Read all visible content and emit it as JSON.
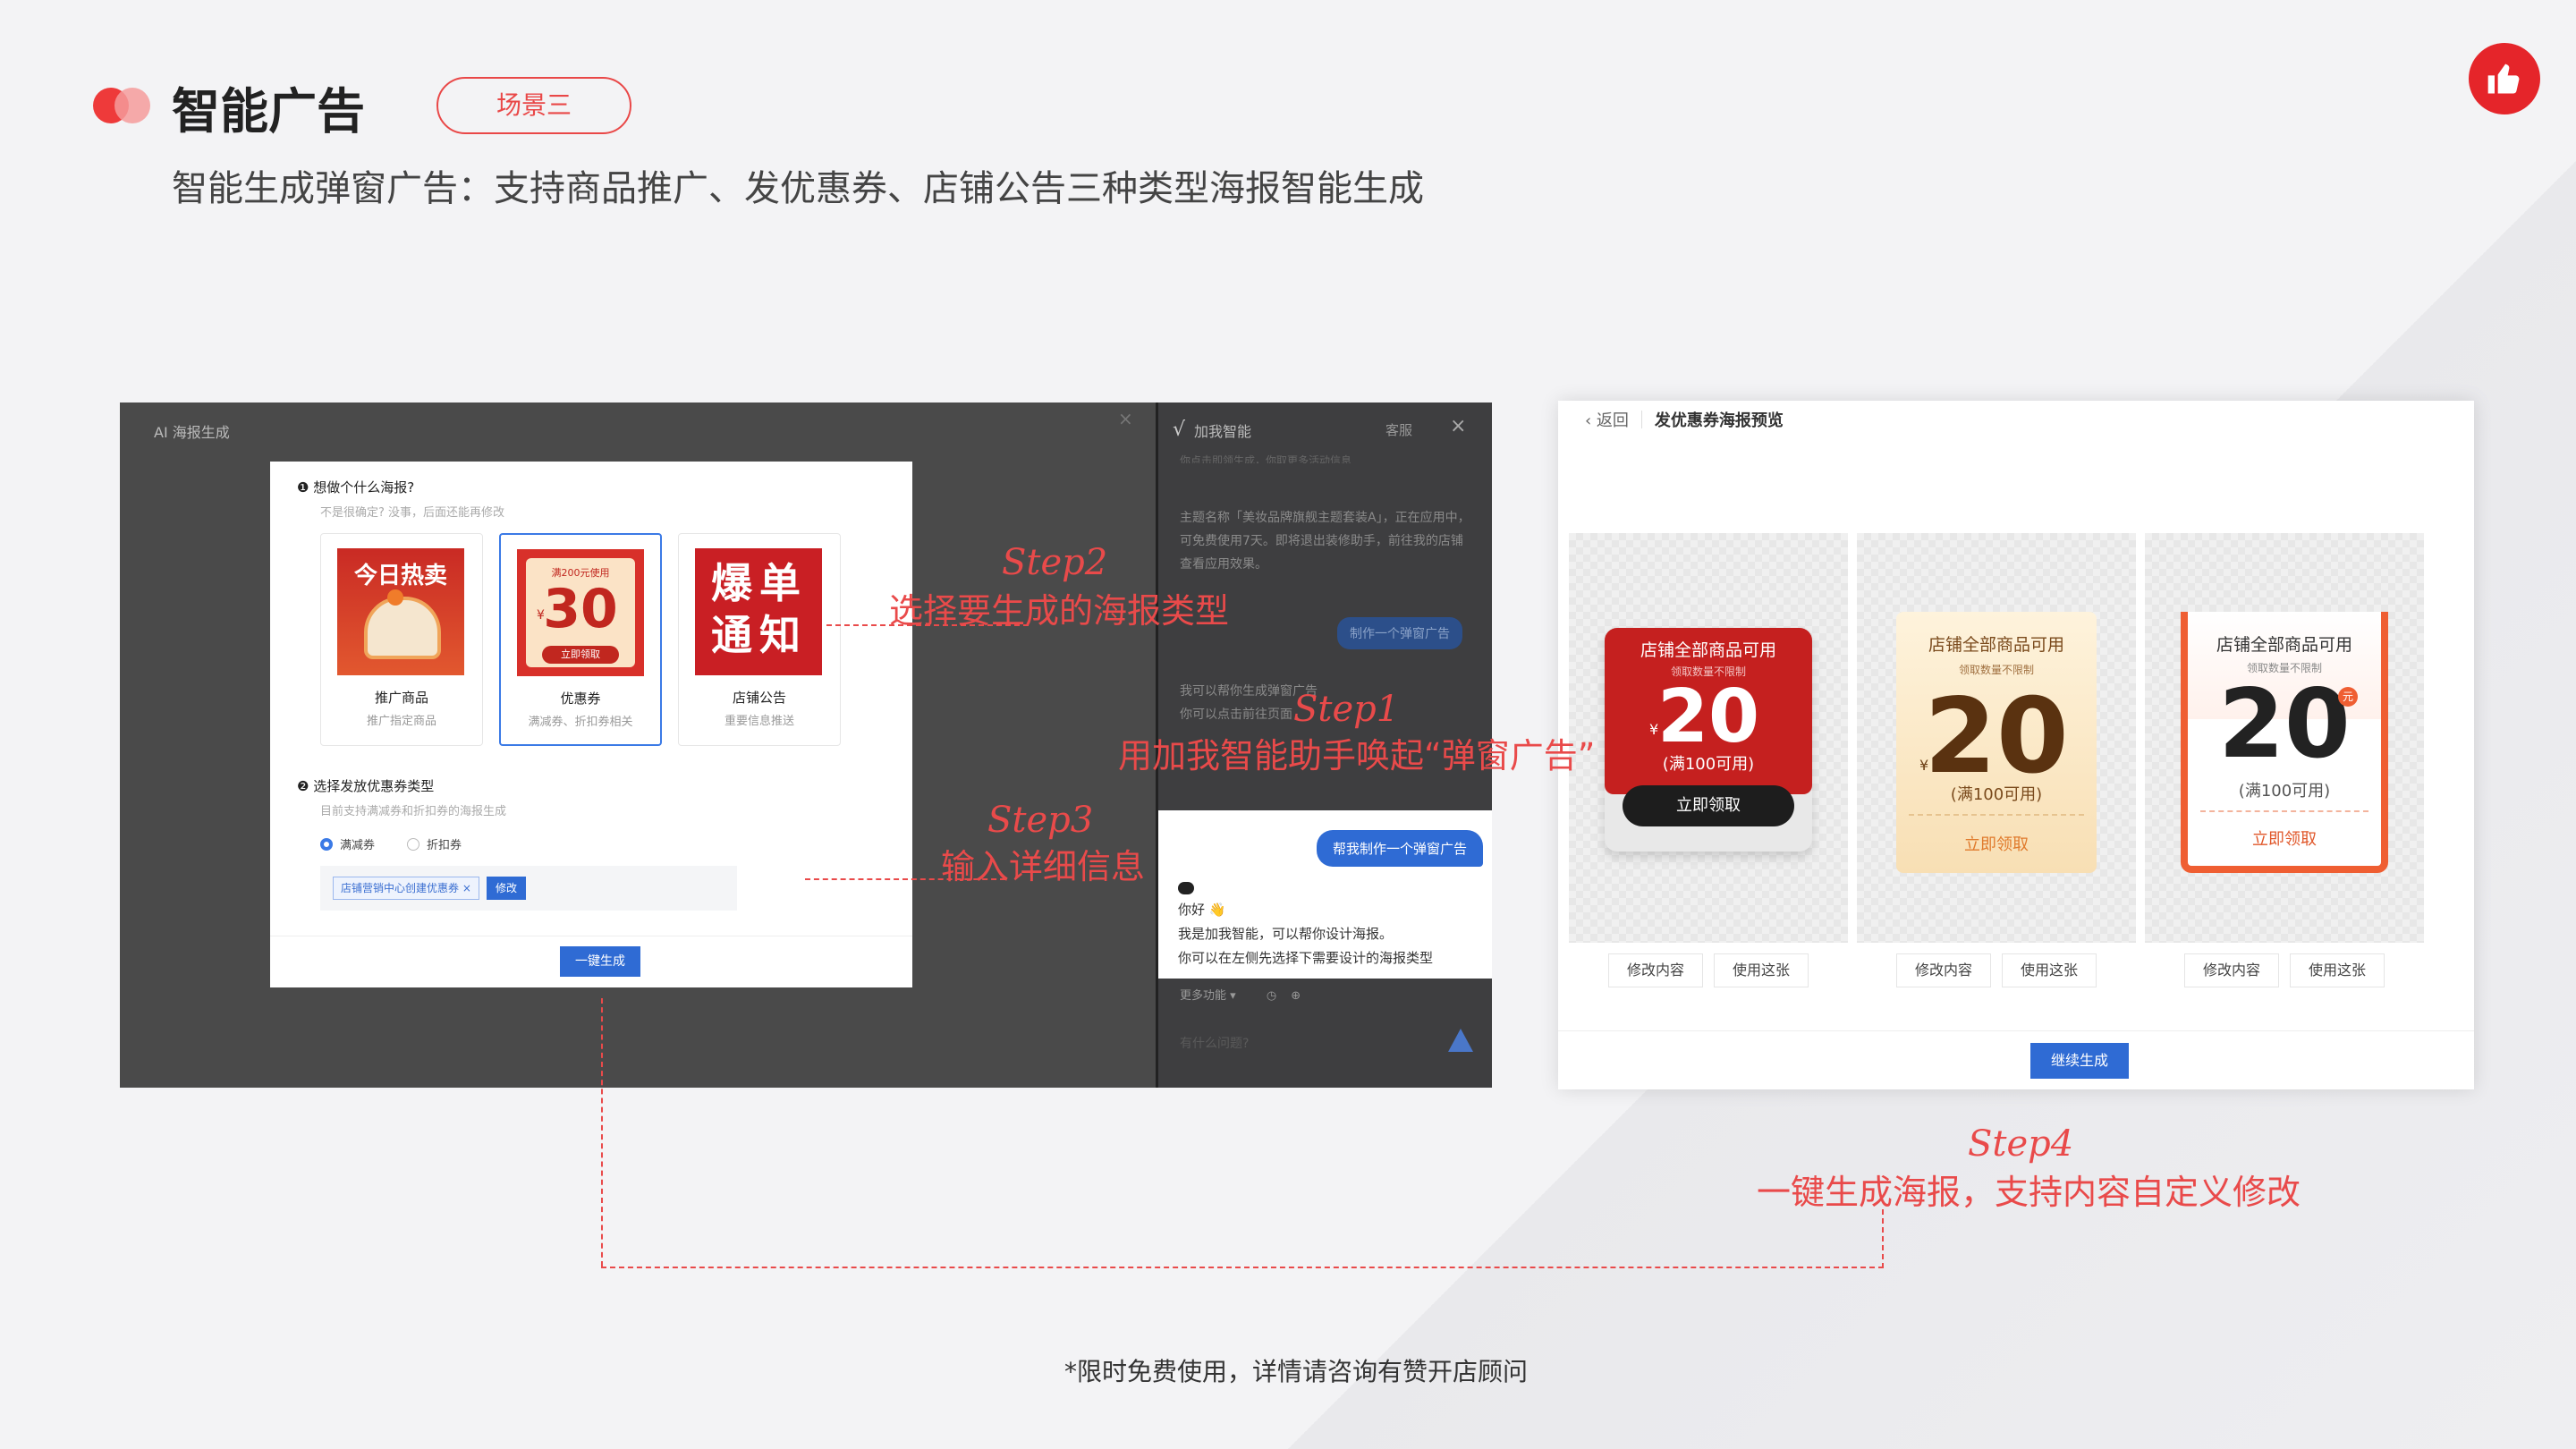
{
  "header": {
    "title": "智能广告",
    "scene_tag": "场景三",
    "subtitle": "智能生成弹窗广告：支持商品推广、发优惠券、店铺公告三种类型海报智能生成"
  },
  "left_shot": {
    "dialog_title": "AI 海报生成",
    "q1_title": "想做个什么海报?",
    "q1_sub": "不是很确定? 没事，后面还能再修改",
    "cards": [
      {
        "poster": "今日热卖",
        "name": "推广商品",
        "desc": "推广指定商品"
      },
      {
        "poster_top": "满200元使用",
        "poster_value": "30",
        "poster_yen": "¥",
        "poster_btn": "立即领取",
        "name": "优惠券",
        "desc": "满减券、折扣券相关"
      },
      {
        "poster": "爆单通知",
        "name": "店铺公告",
        "desc": "重要信息推送"
      }
    ],
    "q2_title": "选择发放优惠券类型",
    "q2_sub": "目前支持满减券和折扣券的海报生成",
    "radio_options": [
      "满减券",
      "折扣券"
    ],
    "chip_label": "店铺营销中心创建优惠券",
    "chip_close": "×",
    "chip_button": "修改",
    "generate_button": "一键生成",
    "chat": {
      "title": "加我智能",
      "service": "客服",
      "close": "×",
      "dim_line_top": "你点击即领生成，你取更多活动信息",
      "dim_paragraph": "主题名称「美妆品牌旗舰主题套装A」，正在应用中，可免费使用7天。即将退出装修助手，前往我的店铺查看应用效果。",
      "dim_bubble": "制作一个弹窗广告",
      "dim_bot_1": "我可以帮你生成弹窗广告",
      "dim_bot_2": "你可以点击前往页面",
      "user_bubble": "帮我制作一个弹窗广告",
      "bot_hello": "你好 👋",
      "bot_line1": "我是加我智能，可以帮你设计海报。",
      "bot_line2": "你可以在左侧先选择下需要设计的海报类型",
      "tools": "更多功能 ▾",
      "input_placeholder": "有什么问题?"
    }
  },
  "right_shot": {
    "back": "返回",
    "title": "发优惠券海报预览",
    "coupons": [
      {
        "title": "店铺全部商品可用",
        "sub": "领取数量不限制",
        "yen": "¥",
        "value": "20",
        "cond": "(满100可用)",
        "btn": "立即领取"
      },
      {
        "title": "店铺全部商品可用",
        "sub": "领取数量不限制",
        "yen": "¥",
        "value": "20",
        "cond": "(满100可用)",
        "btn": "立即领取"
      },
      {
        "title": "店铺全部商品可用",
        "sub": "领取数量不限制",
        "unit": "元",
        "value": "20",
        "cond": "(满100可用)",
        "btn": "立即领取"
      }
    ],
    "edit_button": "修改内容",
    "use_button": "使用这张",
    "continue_button": "继续生成"
  },
  "annotations": {
    "step1_label": "Step1",
    "step1_text": "用加我智能助手唤起“弹窗广告”",
    "step2_label": "Step2",
    "step2_text": "选择要生成的海报类型",
    "step3_label": "Step3",
    "step3_text": "输入详细信息",
    "step4_label": "Step4",
    "step4_text": "一键生成海报，支持内容自定义修改"
  },
  "footnote": "*限时免费使用，详情请咨询有赞开店顾问",
  "colors": {
    "accent_red": "#e94a4a",
    "primary_blue": "#2f6bd4",
    "logo_red": "#e5252a"
  }
}
